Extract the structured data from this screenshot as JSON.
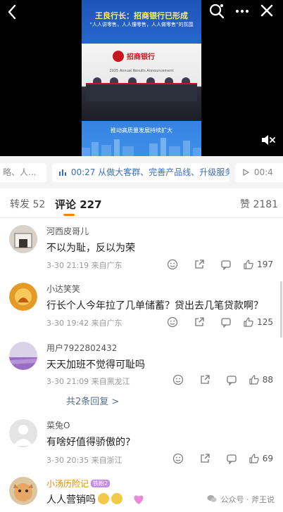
{
  "video": {
    "headline": "王良行长：招商银行已形成",
    "subheadline": "“人人讲零售，人人懂零售，人人做零售”的氛围",
    "bank_name": "招商银行",
    "event": "2025 Annual Results Announcement",
    "subtitle": "推动高质量发展持续扩大"
  },
  "strip": {
    "left_chip": "略、人...",
    "main_chip_time": "00:27",
    "main_chip_text": "从做大客群、完善产品线、升级服务...",
    "right_chip_time": "00:4"
  },
  "tabs": {
    "repost_label": "转发",
    "repost_count": "52",
    "comment_label": "评论",
    "comment_count": "227",
    "like_label": "赞",
    "like_count": "2181"
  },
  "comments": [
    {
      "user": "河西皮哥儿",
      "text": "不以为耻，反以为荣",
      "time": "3-30 21:19",
      "source": "来自广东",
      "likes": "197"
    },
    {
      "user": "小达笑笑",
      "text": "行长个人今年拉了几单储蓄？贷出去几笔贷款啊？",
      "time": "3-30 19:42",
      "source": "来自广东",
      "likes": "125"
    },
    {
      "user": "用户7922802432",
      "text": "天天加班不觉得可耻吗",
      "time": "3-30 21:09",
      "source": "来自黑龙江",
      "likes": "88",
      "replies": "共2条回复 >"
    },
    {
      "user": "菜兔O",
      "text": "有啥好值得骄傲的?",
      "time": "3-30 20:35",
      "source": "来自浙江",
      "likes": "69"
    },
    {
      "user": "小汤历险记",
      "badge": "铁粉2",
      "text": "人人营销吗"
    }
  ],
  "watermark": "公众号 · 斧王说",
  "colors": {
    "accent": "#ff8200",
    "link": "#55708f"
  }
}
